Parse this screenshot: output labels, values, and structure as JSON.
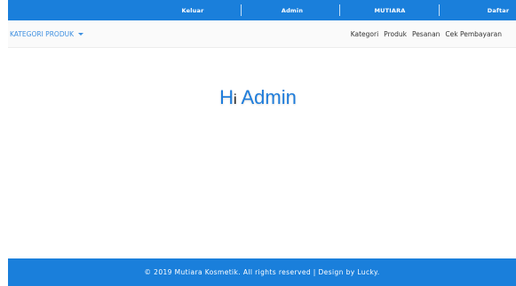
{
  "topbar": {
    "items": [
      {
        "label": "Keluar"
      },
      {
        "label": "Admin"
      },
      {
        "label": "MUTIARA"
      },
      {
        "label": "Daftar"
      }
    ]
  },
  "navbar": {
    "dropdown_label": "KATEGORI PRODUK",
    "links": [
      {
        "label": "Kategori"
      },
      {
        "label": "Produk"
      },
      {
        "label": "Pesanan"
      },
      {
        "label": "Cek Pembayaran"
      }
    ]
  },
  "main": {
    "greeting_h": "H",
    "greeting_i": "i",
    "greeting_name": " Admin"
  },
  "footer": {
    "text": "© 2019 Mutiara Kosmetik. All rights reserved | Design by Lucky."
  },
  "colors": {
    "brand_blue": "#1a7fdb",
    "link_blue": "#3d8fe0"
  }
}
